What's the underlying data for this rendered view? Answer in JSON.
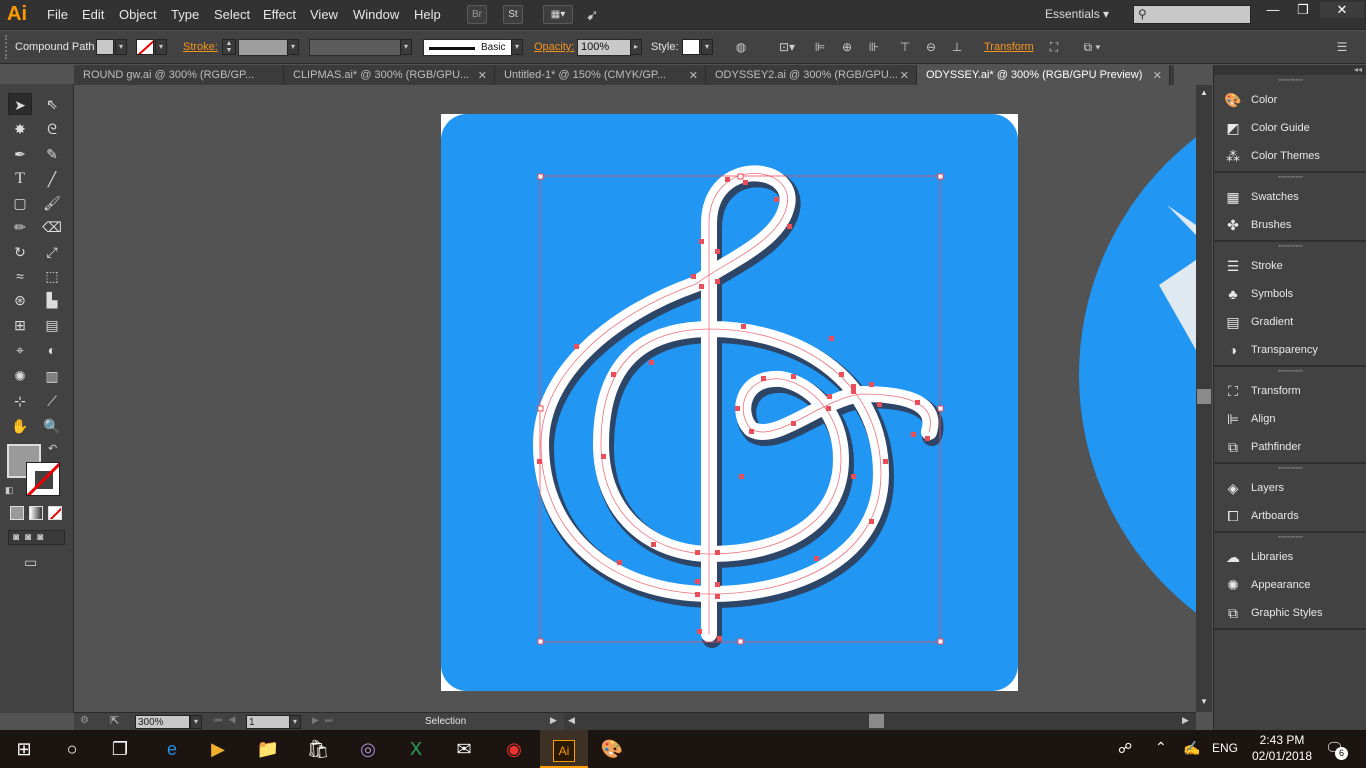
{
  "app": {
    "logo": "Ai",
    "menu": [
      "File",
      "Edit",
      "Object",
      "Type",
      "Select",
      "Effect",
      "View",
      "Window",
      "Help"
    ],
    "bridge_btn": "Br",
    "stock_btn": "St",
    "workspace": "Essentials",
    "search_placeholder": ""
  },
  "control_bar": {
    "selection_type": "Compound Path",
    "stroke_label": "Stroke:",
    "brush_label": "Basic",
    "opacity_label": "Opacity:",
    "opacity_value": "100%",
    "style_label": "Style:",
    "transform_label": "Transform"
  },
  "tabs": [
    {
      "label": "ROUND gw.ai @ 300% (RGB/GP..."
    },
    {
      "label": "CLIPMAS.ai* @ 300% (RGB/GPU..."
    },
    {
      "label": "Untitled-1* @ 150% (CMYK/GP..."
    },
    {
      "label": "ODYSSEY2.ai @ 300% (RGB/GPU..."
    },
    {
      "label": "ODYSSEY.ai* @ 300% (RGB/GPU Preview)"
    }
  ],
  "panels": {
    "group1": [
      "Color",
      "Color Guide",
      "Color Themes"
    ],
    "group2": [
      "Swatches",
      "Brushes"
    ],
    "group3": [
      "Stroke",
      "Symbols",
      "Gradient",
      "Transparency"
    ],
    "group4": [
      "Transform",
      "Align",
      "Pathfinder"
    ],
    "group5": [
      "Layers",
      "Artboards"
    ],
    "group6": [
      "Libraries",
      "Appearance",
      "Graphic Styles"
    ]
  },
  "status": {
    "zoom": "300%",
    "artboard_num": "1",
    "tool_name": "Selection"
  },
  "taskbar": {
    "language": "ENG",
    "time": "2:43 PM",
    "date": "02/01/2018",
    "notifications": "6"
  },
  "colors": {
    "artboard_fill": "#2196f3",
    "symbol_fill": "#ffffff",
    "selection_color": "#e94e5a",
    "ai_orange": "#ff9a00"
  }
}
